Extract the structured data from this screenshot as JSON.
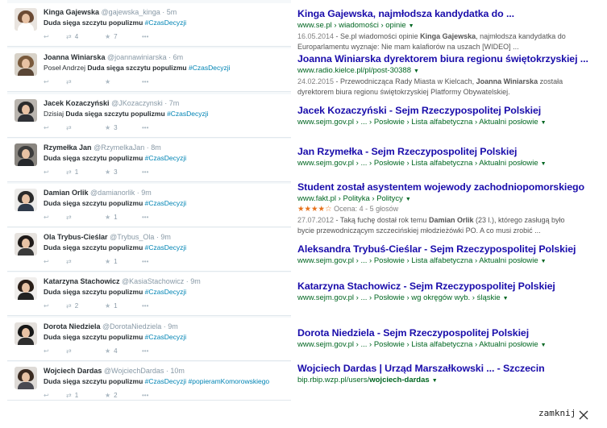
{
  "tweets": [
    {
      "name": "Kinga Gajewska",
      "handle": "@gajewska_kinga",
      "time": "· 5m",
      "prefix": "",
      "bold": "Duda sięga szczytu populizmu",
      "hashtag": "#CzasDecyzji",
      "suffix": "",
      "retweets": "4",
      "favorites": "7"
    },
    {
      "name": "Joanna Winiarska",
      "handle": "@joannawiniarska",
      "time": "· 6m",
      "prefix": "Poseł Andrzej ",
      "bold": "Duda sięga szczytu populizmu",
      "hashtag": "#CzasDecyzji",
      "suffix": "",
      "retweets": "",
      "favorites": ""
    },
    {
      "name": "Jacek Kozaczyński",
      "handle": "@JKozaczynski",
      "time": "· 7m",
      "prefix": "Dzisiaj ",
      "bold": "Duda sięga szczytu populizmu",
      "hashtag": "#CzasDecyzji",
      "suffix": "",
      "retweets": "",
      "favorites": "3"
    },
    {
      "name": "Rzymełka Jan",
      "handle": "@RzymelkaJan",
      "time": "· 8m",
      "prefix": "",
      "bold": "Duda sięga szczytu populizmu",
      "hashtag": "#CzasDecyzji",
      "suffix": "",
      "retweets": "1",
      "favorites": "3"
    },
    {
      "name": "Damian Orlik",
      "handle": "@damianorlik",
      "time": "· 9m",
      "prefix": "",
      "bold": "Duda sięga szczytu populizmu",
      "hashtag": "#CzasDecyzji",
      "suffix": "",
      "retweets": "",
      "favorites": "1"
    },
    {
      "name": "Ola Trybus-Cieślar",
      "handle": "@Trybus_Ola",
      "time": "· 9m",
      "prefix": "",
      "bold": "Duda sięga szczytu populizmu",
      "hashtag": "#CzasDecyzji",
      "suffix": "",
      "retweets": "",
      "favorites": "1"
    },
    {
      "name": "Katarzyna Stachowicz",
      "handle": "@KasiaStachowicz",
      "time": "· 9m",
      "prefix": "",
      "bold": "Duda sięga szczytu populizmu",
      "hashtag": "#CzasDecyzji",
      "suffix": "",
      "retweets": "2",
      "favorites": "1"
    },
    {
      "name": "Dorota Niedziela",
      "handle": "@DorotaNiedziela",
      "time": "· 9m",
      "prefix": "",
      "bold": "Duda sięga szczytu populizmu",
      "hashtag": "#CzasDecyzji",
      "suffix": "",
      "retweets": "",
      "favorites": "4"
    },
    {
      "name": "Wojciech Dardas",
      "handle": "@WojciechDardas",
      "time": "· 10m",
      "prefix": "",
      "bold": "Duda sięga szczytu populizmu",
      "hashtag": "#CzasDecyzji",
      "suffix": " #popieramKomorowskiego",
      "retweets": "1",
      "favorites": "2"
    }
  ],
  "results": [
    {
      "title": "Kinga Gajewska, najmłodsza kandydatka do ...",
      "url": "www.se.pl › wiadomości › opinie",
      "date": "16.05.2014",
      "snippet1_pre": " - Se.pl wiadomości opinie ",
      "snippet1_bold": "Kinga Gajewska",
      "snippet1_post": ", najmłodsza kandydatka do",
      "snippet2": "Europarlamentu wyznaje: Nie mam kalafiorów na uszach [WIDEO] ..."
    },
    {
      "title": "Joanna Winiarska dyrektorem biura regionu świętokrzyskiej ...",
      "url": "www.radio.kielce.pl/pl/post-30388",
      "date": "24.02.2015",
      "snippet1_pre": " - Przewodnicząca Rady Miasta w Kielcach, ",
      "snippet1_bold": "Joanna Winiarska",
      "snippet1_post": " została",
      "snippet2": "dyrektorem biura regionu świętokrzyskiej Platformy Obywatelskiej."
    },
    {
      "title": "Jacek Kozaczyński - Sejm Rzeczypospolitej Polskiej",
      "url": "www.sejm.gov.pl › ... › Posłowie › Lista alfabetyczna › Aktualni posłowie"
    },
    {
      "title": "Jan Rzymełka - Sejm Rzeczypospolitej Polskiej",
      "url": "www.sejm.gov.pl › ... › Posłowie › Lista alfabetyczna › Aktualni posłowie"
    },
    {
      "title": "Student został asystentem wojewody zachodniopomorskiego",
      "url": "www.fakt.pl › Polityka › Politycy",
      "stars": "★★★★☆",
      "rating": "Ocena: 4 - 5 głosów",
      "date": "27.07.2012",
      "snippet1_pre": " - Taką fuchę dostał rok temu ",
      "snippet1_bold": "Damian Orlik",
      "snippet1_post": " (23 l.), którego zasługą było",
      "snippet2": "bycie przewodniczącym szczecińskiej młodzieżówki PO. A co musi zrobić ..."
    },
    {
      "title": "Aleksandra Trybuś-Cieślar - Sejm Rzeczypospolitej Polskiej",
      "url": "www.sejm.gov.pl › ... › Posłowie › Lista alfabetyczna › Aktualni posłowie"
    },
    {
      "title": "Katarzyna Stachowicz - Sejm Rzeczypospolitej Polskiej",
      "url": "www.sejm.gov.pl › ... › Posłowie › wg okręgów wyb. › śląskie"
    },
    {
      "title": "Dorota Niedziela - Sejm Rzeczypospolitej Polskiej",
      "url": "www.sejm.gov.pl › ... › Posłowie › Lista alfabetyczna › Aktualni posłowie"
    },
    {
      "title": "Wojciech Dardas | Urząd Marszałkowski ... - Szczecin",
      "url_pre": "bip.rbip.wzp.pl/users/",
      "url_bold": "wojciech-dardas"
    }
  ],
  "footer": {
    "close_label": "zamknij"
  },
  "colors": {
    "link_blue": "#1a0dab",
    "url_green": "#006621",
    "hashtag_blue": "#0084b4"
  }
}
